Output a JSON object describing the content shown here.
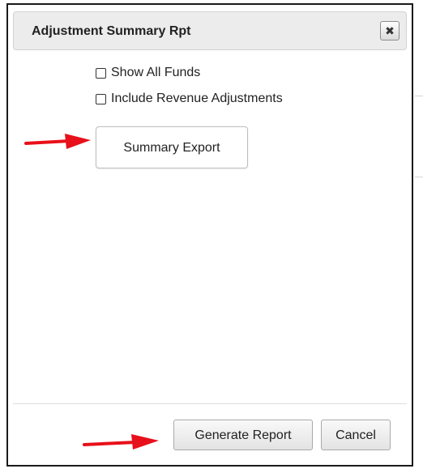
{
  "dialog": {
    "title": "Adjustment Summary Rpt",
    "close_icon": "close-icon",
    "close_glyph": "✖"
  },
  "options": [
    {
      "label": "Show All Funds",
      "checked": false
    },
    {
      "label": "Include Revenue Adjustments",
      "checked": false
    }
  ],
  "buttons": {
    "summary_export": "Summary Export",
    "generate_report": "Generate Report",
    "cancel": "Cancel"
  },
  "annotations": {
    "arrow_color": "#e8101a",
    "arrow_icon": "arrow-right-icon"
  }
}
